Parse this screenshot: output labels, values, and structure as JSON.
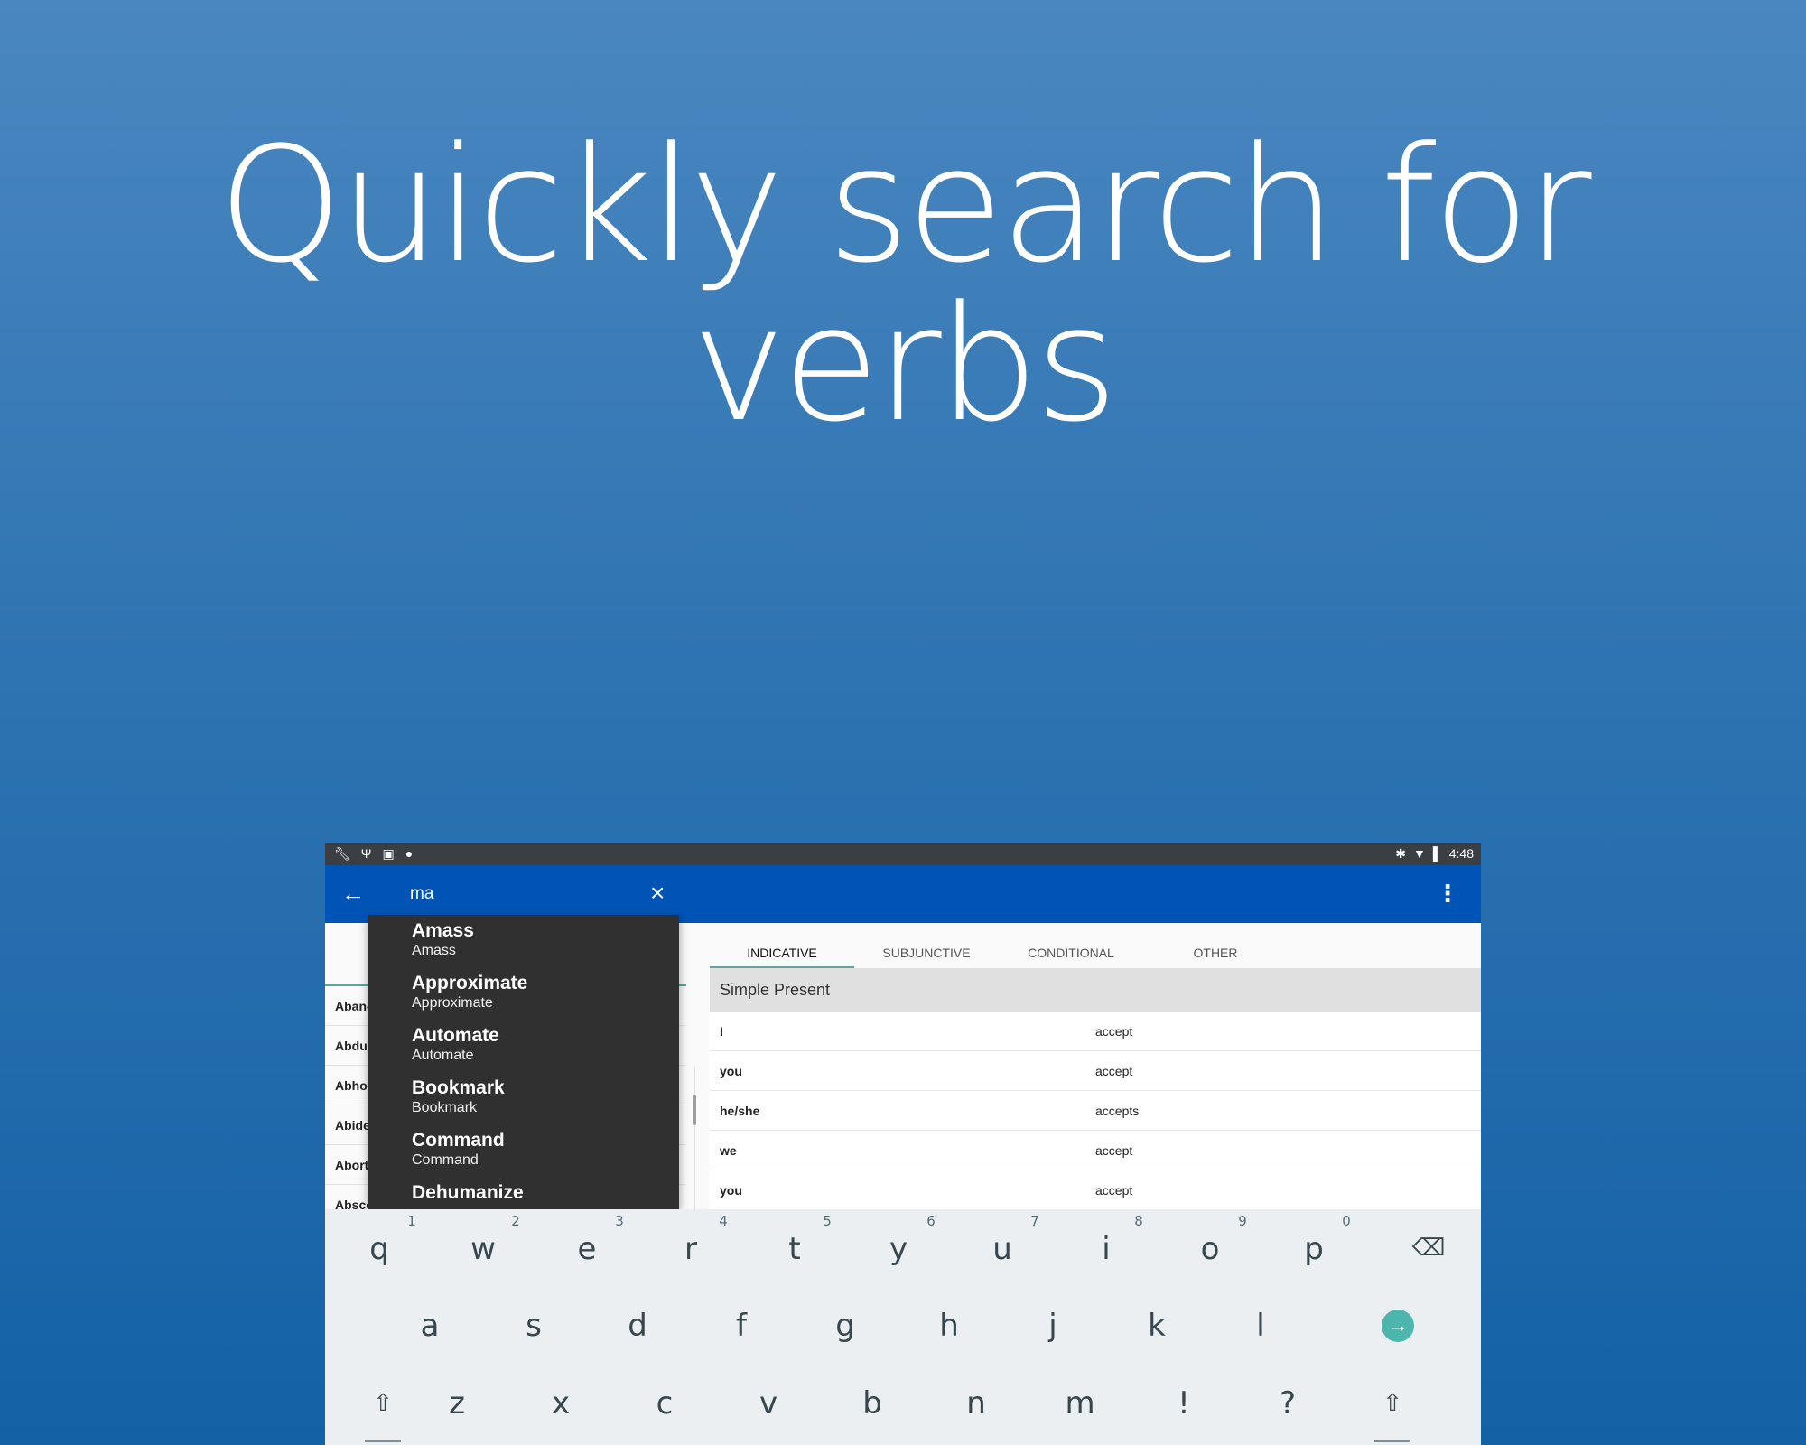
{
  "headline": "Quickly search for verbs",
  "status_bar": {
    "left_icons": [
      "wrench-icon",
      "usb-icon",
      "lock-icon",
      "android-icon"
    ],
    "right_icons": [
      "bluetooth-icon",
      "wifi-icon",
      "battery-icon"
    ],
    "time": "4:48"
  },
  "app_bar": {
    "search_value": "ma",
    "back_icon": "arrow-left-icon",
    "clear_icon": "close-icon",
    "menu_icon": "more-vert-icon"
  },
  "suggestions": [
    {
      "title": "Amass",
      "subtitle": "Amass"
    },
    {
      "title": "Approximate",
      "subtitle": "Approximate"
    },
    {
      "title": "Automate",
      "subtitle": "Automate"
    },
    {
      "title": "Bookmark",
      "subtitle": "Bookmark"
    },
    {
      "title": "Command",
      "subtitle": "Command"
    },
    {
      "title": "Dehumanize",
      "subtitle": ""
    }
  ],
  "verb_list": [
    "Abandon",
    "Abduct",
    "Abhor",
    "Abide",
    "Abort",
    "Abscond"
  ],
  "tabs": [
    "INDICATIVE",
    "SUBJUNCTIVE",
    "CONDITIONAL",
    "OTHER"
  ],
  "active_tab": "INDICATIVE",
  "section_title": "Simple Present",
  "conjugations": [
    {
      "person": "I",
      "form": "accept"
    },
    {
      "person": "you",
      "form": "accept"
    },
    {
      "person": "he/she",
      "form": "accepts"
    },
    {
      "person": "we",
      "form": "accept"
    },
    {
      "person": "you",
      "form": "accept"
    }
  ],
  "keyboard": {
    "row1": [
      {
        "hint": "1",
        "key": "q"
      },
      {
        "hint": "2",
        "key": "w"
      },
      {
        "hint": "3",
        "key": "e"
      },
      {
        "hint": "4",
        "key": "r"
      },
      {
        "hint": "5",
        "key": "t"
      },
      {
        "hint": "6",
        "key": "y"
      },
      {
        "hint": "7",
        "key": "u"
      },
      {
        "hint": "8",
        "key": "i"
      },
      {
        "hint": "9",
        "key": "o"
      },
      {
        "hint": "0",
        "key": "p"
      }
    ],
    "row2": [
      "a",
      "s",
      "d",
      "f",
      "g",
      "h",
      "j",
      "k",
      "l"
    ],
    "row3": [
      "z",
      "x",
      "c",
      "v",
      "b",
      "n",
      "m",
      "!",
      "?"
    ],
    "accent_color": "#4db6ac"
  }
}
